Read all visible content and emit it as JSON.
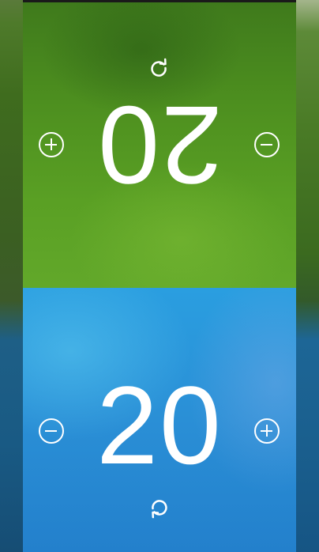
{
  "players": {
    "top": {
      "score": "20",
      "color": "#52982a",
      "orientation": "upside-down",
      "controls": {
        "increment_icon": "plus-circle-icon",
        "decrement_icon": "minus-circle-icon",
        "reset_icon": "refresh-icon"
      }
    },
    "bottom": {
      "score": "20",
      "color": "#2a8fd6",
      "orientation": "upright",
      "controls": {
        "increment_icon": "plus-circle-icon",
        "decrement_icon": "minus-circle-icon",
        "reset_icon": "refresh-icon"
      }
    }
  }
}
